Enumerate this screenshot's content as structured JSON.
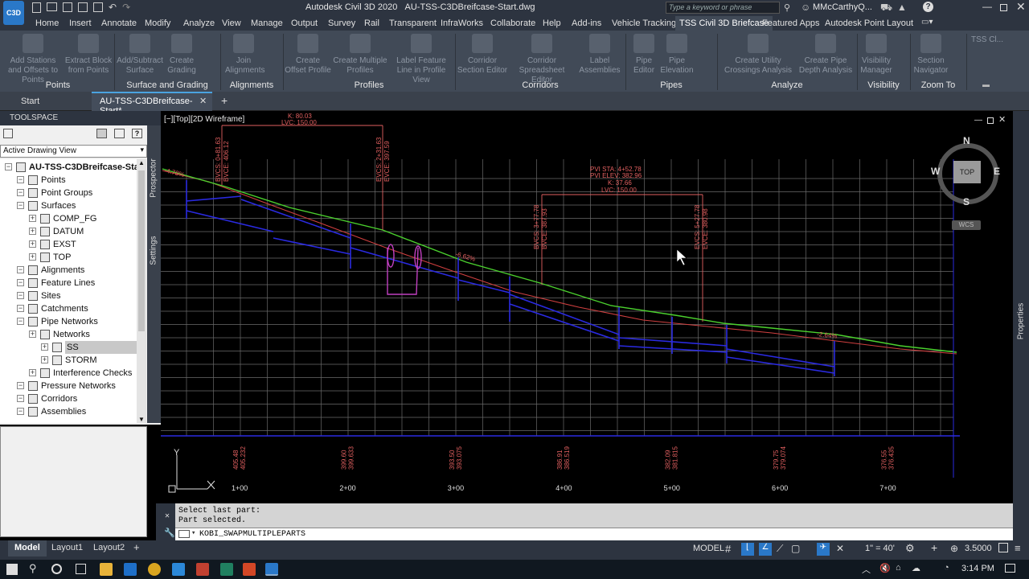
{
  "titlebar": {
    "app_title": "Autodesk Civil 3D 2020",
    "file_title": "AU-TSS-C3DBreifcase-Start.dwg",
    "search_placeholder": "Type a keyword or phrase",
    "user": "MMcCarthyQ...",
    "app_logo": "C3D"
  },
  "ribbon_tabs": [
    "Home",
    "Insert",
    "Annotate",
    "Modify",
    "Analyze",
    "View",
    "Manage",
    "Output",
    "Survey",
    "Rail",
    "Transparent",
    "InfraWorks",
    "Collaborate",
    "Help",
    "Add-ins",
    "Vehicle Tracking",
    "TSS Civil 3D Briefcase",
    "Featured Apps",
    "Autodesk Point Layout"
  ],
  "ribbon": {
    "buttons": [
      {
        "label": "Add Stations and Offsets to Points",
        "icon": "stations-icon"
      },
      {
        "label": "Extract Block from Points",
        "icon": "block-icon"
      },
      {
        "label": "Add/Subtract Surface",
        "icon": "surface-icon"
      },
      {
        "label": "Create Grading",
        "icon": "grading-icon"
      },
      {
        "label": "Join Alignments",
        "icon": "join-alignments-icon"
      },
      {
        "label": "Create Offset Profile",
        "icon": "offset-profile-icon"
      },
      {
        "label": "Create Multiple Profiles",
        "icon": "multiple-profiles-icon"
      },
      {
        "label": "Label Feature Line in Profile View",
        "icon": "label-feature-line-icon"
      },
      {
        "label": "Corridor Section Editor",
        "icon": "corridor-section-icon"
      },
      {
        "label": "Corridor Spreadsheet Editor",
        "icon": "corridor-spreadsheet-icon"
      },
      {
        "label": "Label Assemblies",
        "icon": "label-assemblies-icon"
      },
      {
        "label": "Pipe Editor",
        "icon": "pipe-editor-icon"
      },
      {
        "label": "Pipe Elevation",
        "icon": "pipe-elevation-icon"
      },
      {
        "label": "Create Utility Crossings Analysis",
        "icon": "utility-crossings-icon"
      },
      {
        "label": "Create Pipe Depth Analysis",
        "icon": "pipe-depth-icon"
      },
      {
        "label": "Visibility Manager",
        "icon": "visibility-icon"
      },
      {
        "label": "Section Navigator",
        "icon": "section-navigator-icon"
      },
      {
        "label": "TSS Cl...",
        "icon": "tss-icon"
      }
    ],
    "panels": [
      "Points",
      "Surface and Grading",
      "Alignments",
      "Profiles",
      "Corridors",
      "Pipes",
      "Analyze",
      "Visibility",
      "Zoom To"
    ]
  },
  "file_tabs": {
    "start": "Start",
    "current": "AU-TSS-C3DBreifcase-Start*"
  },
  "toolspace": {
    "title": "TOOLSPACE",
    "view_select": "Active Drawing View",
    "side_tabs": [
      "Prospector",
      "Settings"
    ],
    "tree": [
      {
        "label": "AU-TSS-C3DBreifcase-Start",
        "level": 0,
        "bold": true
      },
      {
        "label": "Points",
        "level": 1
      },
      {
        "label": "Point Groups",
        "level": 1
      },
      {
        "label": "Surfaces",
        "level": 1
      },
      {
        "label": "COMP_FG",
        "level": 2
      },
      {
        "label": "DATUM",
        "level": 2
      },
      {
        "label": "EXST",
        "level": 2
      },
      {
        "label": "TOP",
        "level": 2
      },
      {
        "label": "Alignments",
        "level": 1
      },
      {
        "label": "Feature Lines",
        "level": 1
      },
      {
        "label": "Sites",
        "level": 1
      },
      {
        "label": "Catchments",
        "level": 1
      },
      {
        "label": "Pipe Networks",
        "level": 1
      },
      {
        "label": "Networks",
        "level": 2
      },
      {
        "label": "SS",
        "level": 3,
        "selected": true
      },
      {
        "label": "STORM",
        "level": 3
      },
      {
        "label": "Interference Checks",
        "level": 2
      },
      {
        "label": "Pressure Networks",
        "level": 1
      },
      {
        "label": "Corridors",
        "level": 1
      },
      {
        "label": "Assemblies",
        "level": 1
      }
    ]
  },
  "viewport": {
    "label": "[−][Top][2D Wireframe]",
    "compass": {
      "n": "N",
      "s": "S",
      "e": "E",
      "w": "W",
      "center": "TOP",
      "wcs": "WCS"
    },
    "ucs_y": "Y",
    "properties_tab": "Properties"
  },
  "profile": {
    "grades": [
      "-4.78%",
      "-6.62%",
      "-2.64%"
    ],
    "vc1": {
      "k": "K: 80.03",
      "lvc": "LVC: 150.00",
      "bvcs": "BVCS: 0+81.63",
      "bvce": "BVCE: 406.12",
      "evcs": "EVCS: 2+31.63",
      "evce": "EVCE: 397.59"
    },
    "vc2": {
      "pvi_sta": "PVI STA: 4+52.78",
      "pvi_elev": "PVI ELEV: 382.96",
      "k": "K: 37.66",
      "lvc": "LVC: 150.00",
      "bvcs": "BVCS: 3+77.78",
      "bvce": "BVCE: 387.93",
      "evcs": "EVCS: 5+27.78",
      "evce": "EVCE: 380.98"
    },
    "elevations": [
      {
        "a": "405.48",
        "b": "405.232"
      },
      {
        "a": "399.60",
        "b": "399.633"
      },
      {
        "a": "393.50",
        "b": "393.075"
      },
      {
        "a": "386.91",
        "b": "386.519"
      },
      {
        "a": "382.09",
        "b": "381.815"
      },
      {
        "a": "379.75",
        "b": "379.074"
      },
      {
        "a": "376.55",
        "b": "376.435"
      }
    ],
    "stations": [
      "1+00",
      "2+00",
      "3+00",
      "4+00",
      "5+00",
      "6+00",
      "7+00"
    ]
  },
  "command": {
    "history": [
      "Select last part:",
      "Part selected."
    ],
    "current": "KOBI_SWAPMULTIPLEPARTS"
  },
  "layout_tabs": [
    "Model",
    "Layout1",
    "Layout2"
  ],
  "status": {
    "model": "MODEL",
    "scale": "1\" = 40'",
    "value": "3.5000"
  },
  "taskbar": {
    "time": "3:14 PM"
  },
  "colors": {
    "profile_green": "#4bd12e",
    "grid": "#6b6b6b",
    "label_red": "#e26060",
    "pipe_blue": "#2a2ae0",
    "highlight": "#c040c0"
  }
}
